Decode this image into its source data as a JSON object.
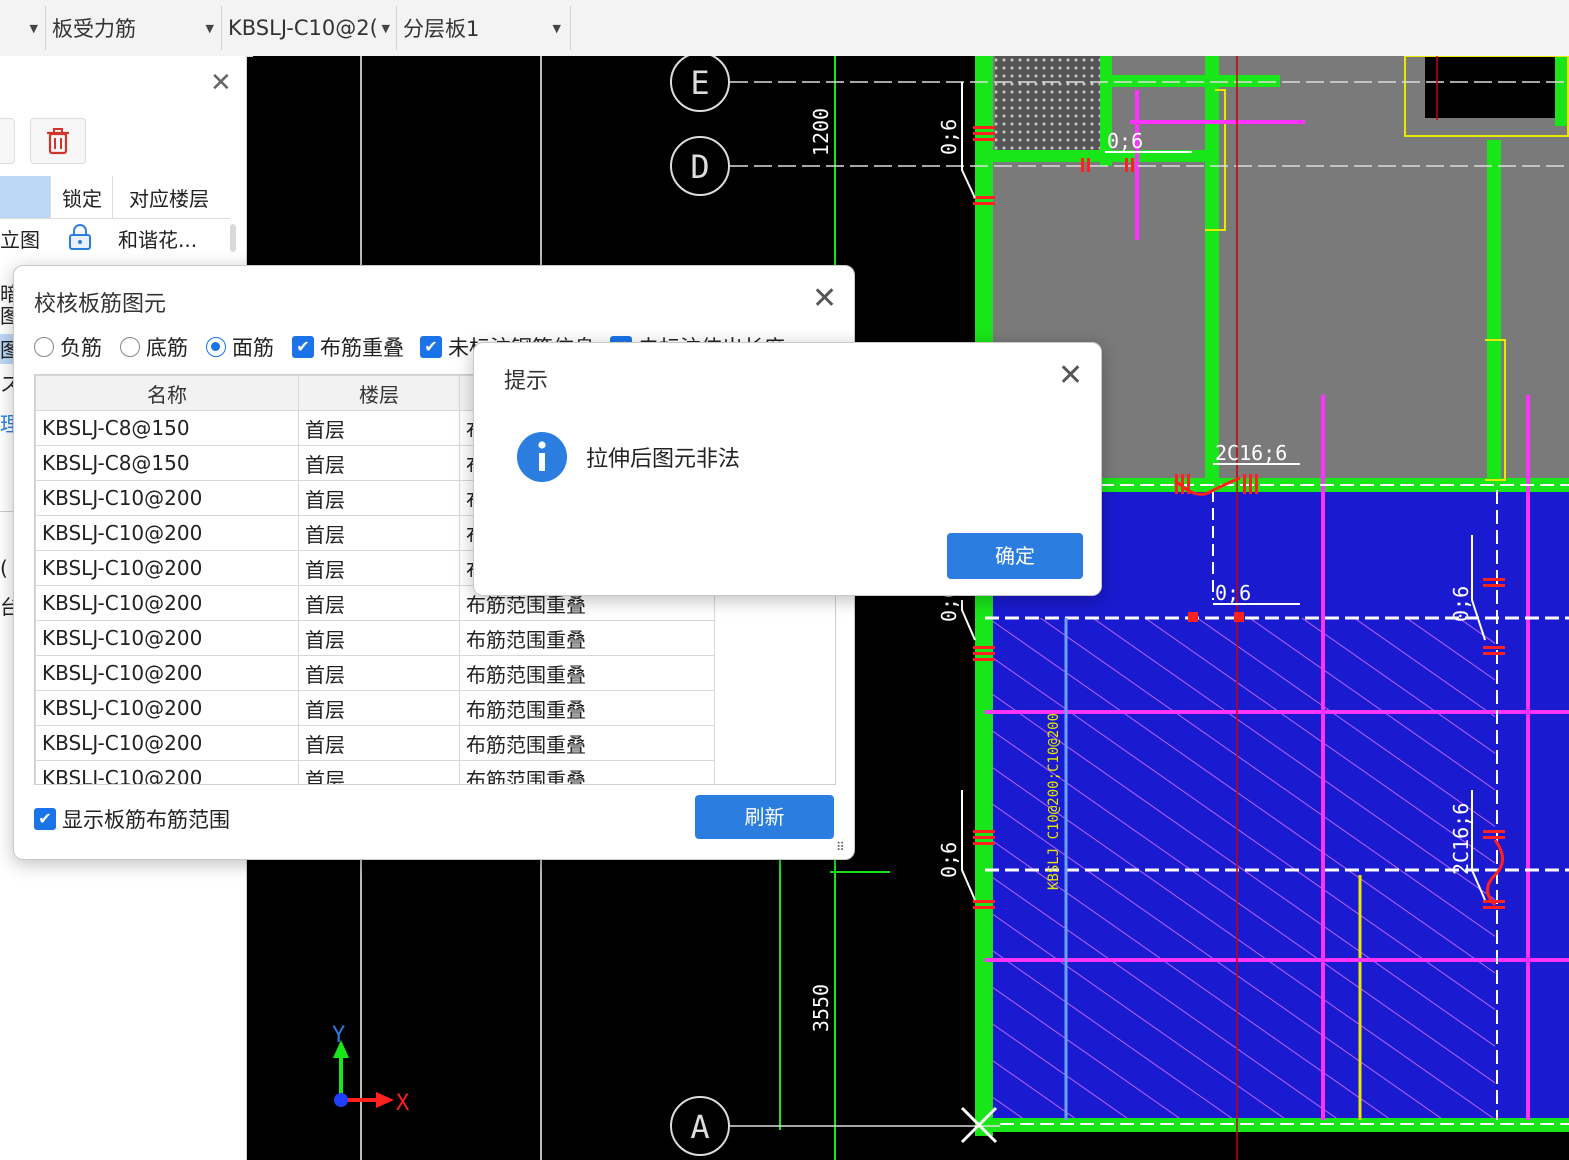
{
  "toolbar": {
    "combo1": "",
    "combo2": "板受力筋",
    "combo3": "KBSLJ-C10@2(",
    "combo4": "分层板1"
  },
  "left_panel": {
    "col_headers": [
      "锁定",
      "对应楼层"
    ],
    "row1_prefix": "立图",
    "row1_floor": "和谐花...",
    "partial_chars": [
      "暗",
      "图",
      "图",
      "图",
      "ス",
      "理",
      "(",
      "台"
    ]
  },
  "check_dialog": {
    "title": "校核板筋图元",
    "options": {
      "neg": "负筋",
      "bottom": "底筋",
      "top": "面筋",
      "overlap": "布筋重叠",
      "unmarked": "未标注钢筋信息",
      "third": "未标注伸出长度"
    },
    "table": {
      "headers": [
        "名称",
        "楼层",
        ""
      ],
      "rows": [
        [
          "KBSLJ-C8@150",
          "首层",
          "布筋范围重叠"
        ],
        [
          "KBSLJ-C8@150",
          "首层",
          "布筋范围重叠"
        ],
        [
          "KBSLJ-C10@200",
          "首层",
          "布筋范围重叠"
        ],
        [
          "KBSLJ-C10@200",
          "首层",
          "布筋范围重叠"
        ],
        [
          "KBSLJ-C10@200",
          "首层",
          "布筋范围重叠"
        ],
        [
          "KBSLJ-C10@200",
          "首层",
          "布筋范围重叠"
        ],
        [
          "KBSLJ-C10@200",
          "首层",
          "布筋范围重叠"
        ],
        [
          "KBSLJ-C10@200",
          "首层",
          "布筋范围重叠"
        ],
        [
          "KBSLJ-C10@200",
          "首层",
          "布筋范围重叠"
        ],
        [
          "KBSLJ-C10@200",
          "首层",
          "布筋范围重叠"
        ],
        [
          "KBSLJ-C10@200",
          "首层",
          "布筋范围重叠"
        ]
      ]
    },
    "show_range": "显示板筋布筋范围",
    "refresh": "刷新"
  },
  "alert": {
    "title": "提示",
    "message": "拉伸后图元非法",
    "ok": "确定"
  },
  "cad": {
    "axis_labels": [
      "E",
      "D",
      "A"
    ],
    "dims": [
      "1200",
      "3550"
    ],
    "rebar_labels": [
      "0;6",
      "0;6",
      "0;6",
      "0;6",
      "0;6",
      "0;6",
      "2C16;6",
      "2C16;6",
      "KBSLJ C10@200;C10@200"
    ],
    "ucs_x": "X",
    "ucs_y": "Y"
  },
  "colors": {
    "accent": "#2b7de0",
    "cad_green": "#19e619",
    "cad_magenta": "#ff33ff",
    "slab_blue": "#1a1ad0"
  }
}
